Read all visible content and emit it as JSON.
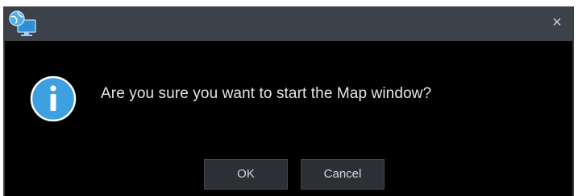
{
  "dialog": {
    "close_glyph": "×",
    "app_icon": "globe-monitor-icon",
    "message_icon": "info-icon",
    "message": "Are you sure you want to start the Map window?",
    "buttons": {
      "ok_label": "OK",
      "cancel_label": "Cancel"
    }
  },
  "colors": {
    "titlebar": "#3d424a",
    "body": "#000000",
    "info_blue": "#3ea0e0",
    "button_bg": "#2c2f34",
    "text": "#e6e6e6"
  }
}
